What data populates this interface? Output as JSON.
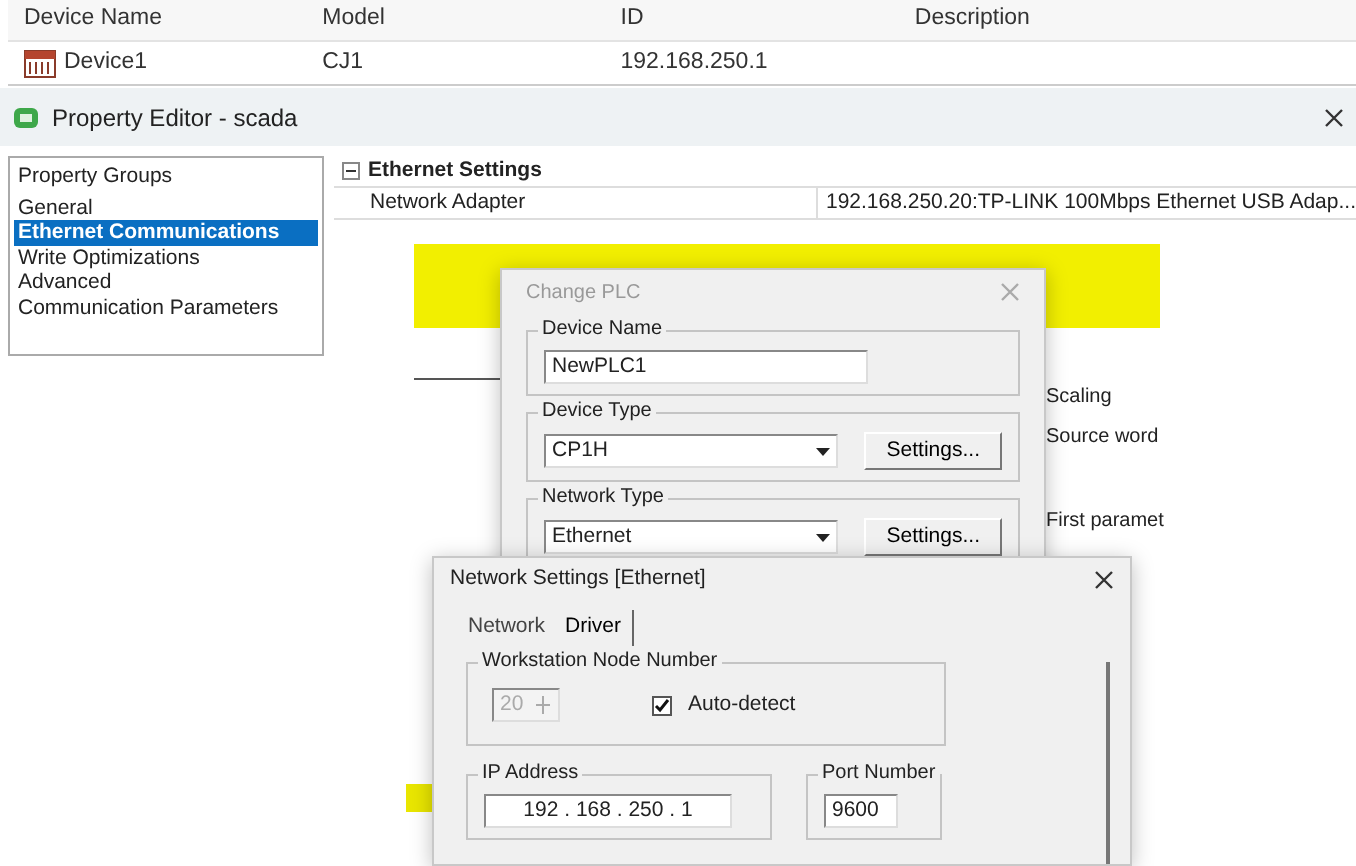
{
  "device_table": {
    "columns": [
      "Device Name",
      "Model",
      "ID",
      "Description"
    ],
    "rows": [
      {
        "cells": [
          "Device1",
          "CJ1",
          "192.168.250.1",
          ""
        ]
      }
    ]
  },
  "property_editor": {
    "title": "Property Editor - scada",
    "groups": [
      {
        "label": "Property Groups",
        "selected": false
      },
      {
        "label": "General",
        "selected": false
      },
      {
        "label": "Ethernet Communications",
        "selected": true
      },
      {
        "label": "Write Optimizations",
        "selected": false
      },
      {
        "label": "Advanced",
        "selected": false
      },
      {
        "label": "Communication Parameters",
        "selected": false
      }
    ],
    "section": {
      "title": "Ethernet Settings",
      "expanded": true,
      "properties": [
        {
          "name": "Network Adapter",
          "value": "192.168.250.20:TP-LINK 100Mbps Ethernet USB Adap..."
        }
      ]
    }
  },
  "background_labels": [
    "Scaling",
    "Source word",
    "First paramet"
  ],
  "change_plc": {
    "title": "Change PLC",
    "device_name": {
      "label": "Device Name",
      "value": "NewPLC1"
    },
    "device_type": {
      "label": "Device Type",
      "value": "CP1H",
      "button": "Settings..."
    },
    "network_type": {
      "label": "Network Type",
      "value": "Ethernet",
      "button": "Settings..."
    }
  },
  "network_settings": {
    "title": "Network Settings [Ethernet]",
    "tabs": [
      {
        "label": "Network",
        "selected": false
      },
      {
        "label": "Driver",
        "selected": true
      }
    ],
    "node_number": {
      "label": "Workstation Node Number",
      "value": "20",
      "disabled": true,
      "auto_detect": {
        "label": "Auto-detect",
        "checked": true
      }
    },
    "ip_address": {
      "label": "IP Address",
      "value": "192 . 168 . 250 . 1"
    },
    "port_number": {
      "label": "Port Number",
      "value": "9600"
    }
  }
}
